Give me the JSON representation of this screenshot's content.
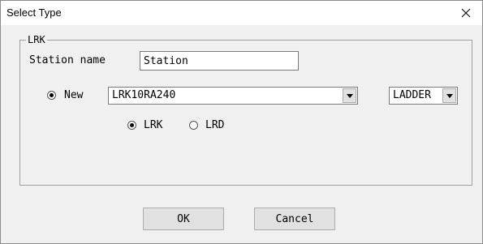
{
  "window": {
    "title": "Select Type",
    "close_glyph": "✕"
  },
  "group": {
    "label": "LRK",
    "station_name_label": "Station name",
    "station_name_value": "Station",
    "new_label": "New",
    "model_value": "LRK10RA240",
    "type_value": "LADDER",
    "option_lrk_label": "LRK",
    "option_lrd_label": "LRD",
    "new_checked": true,
    "lrk_checked": true,
    "lrd_checked": false
  },
  "buttons": {
    "ok_label": "OK",
    "cancel_label": "Cancel"
  }
}
